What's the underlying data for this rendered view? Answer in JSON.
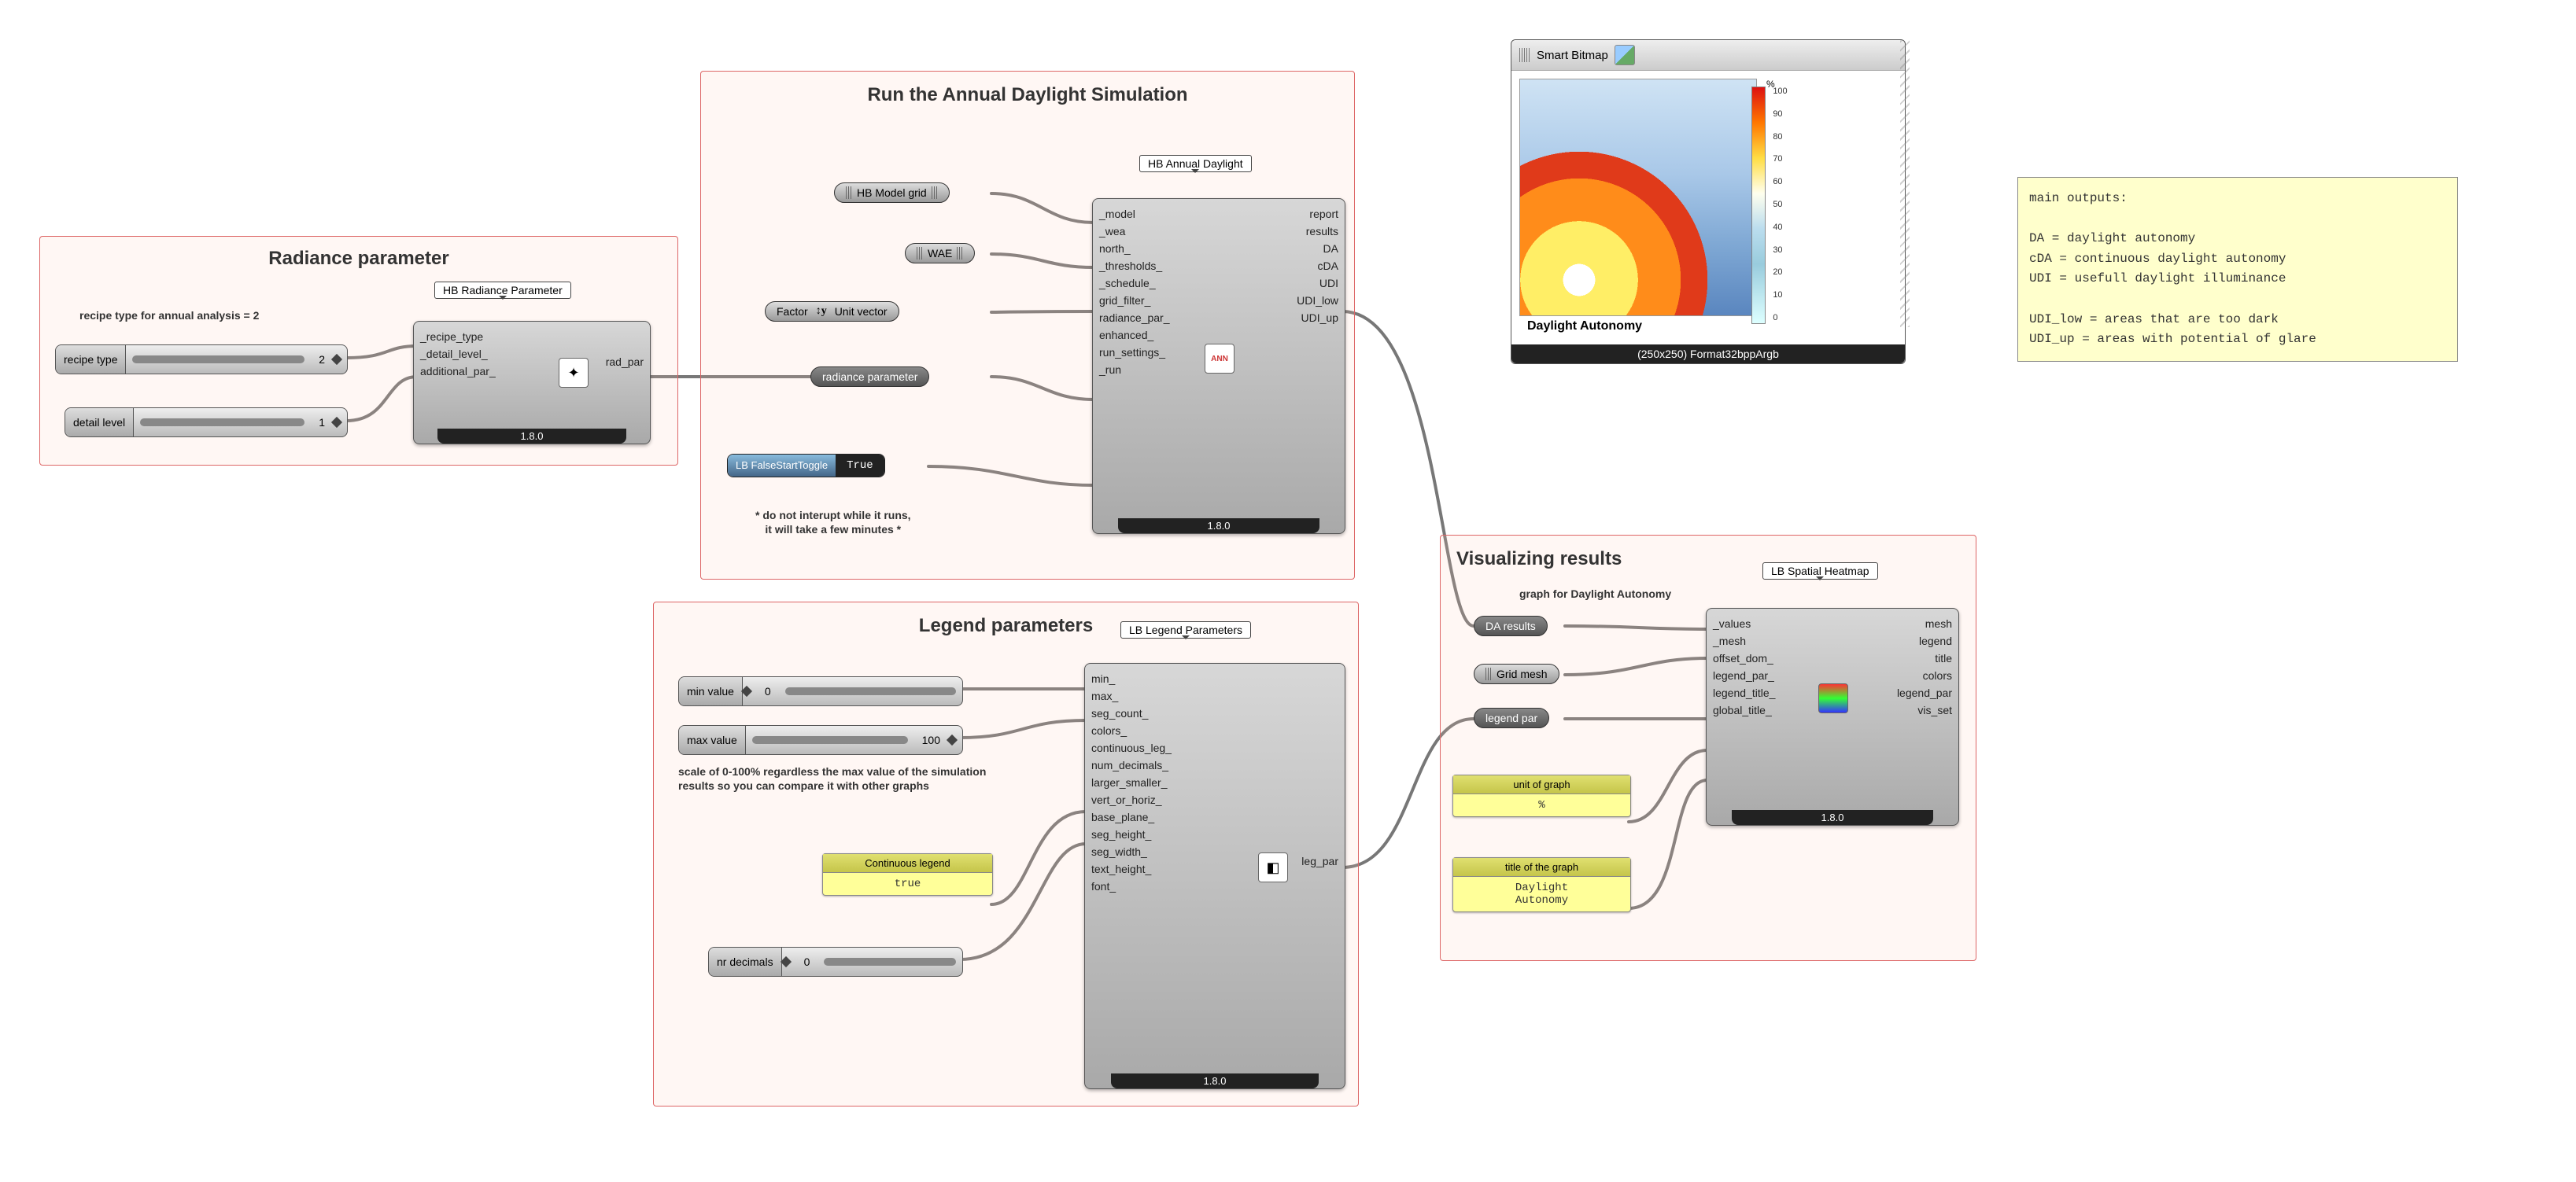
{
  "groups": {
    "radiance": {
      "title": "Radiance parameter",
      "sub": "recipe type for annual analysis = 2"
    },
    "sim": {
      "title": "Run the Annual Daylight Simulation",
      "note": "* do not interupt while it runs,\nit will take a few minutes *"
    },
    "legend": {
      "title": "Legend parameters",
      "note": "scale of 0-100% regardless the max value of the simulation results so you can compare it with other graphs"
    },
    "viz": {
      "title": "Visualizing results",
      "sub": "graph for Daylight Autonomy"
    }
  },
  "labels": {
    "hb_radiance": "HB Radiance Parameter",
    "hb_annual": "HB Annual Daylight",
    "lb_legend": "LB Legend Parameters",
    "lb_heat": "LB Spatial Heatmap"
  },
  "radiance_comp": {
    "inputs": [
      "_recipe_type",
      "_detail_level_",
      "additional_par_"
    ],
    "outputs": [
      "rad_par"
    ],
    "version": "1.8.0"
  },
  "annual_comp": {
    "inputs": [
      "_model",
      "_wea",
      "north_",
      "_thresholds_",
      "_schedule_",
      "grid_filter_",
      "radiance_par_",
      "enhanced_",
      "run_settings_",
      "_run"
    ],
    "outputs": [
      "report",
      "results",
      "DA",
      "cDA",
      "UDI",
      "UDI_low",
      "UDI_up"
    ],
    "version": "1.8.0"
  },
  "legend_comp": {
    "inputs": [
      "min_",
      "max_",
      "seg_count_",
      "colors_",
      "continuous_leg_",
      "num_decimals_",
      "larger_smaller_",
      "vert_or_horiz_",
      "base_plane_",
      "seg_height_",
      "seg_width_",
      "text_height_",
      "font_"
    ],
    "outputs": [
      "leg_par"
    ],
    "version": "1.8.0"
  },
  "heat_comp": {
    "inputs": [
      "_values",
      "_mesh",
      "offset_dom_",
      "legend_par_",
      "legend_title_",
      "global_title_"
    ],
    "outputs": [
      "mesh",
      "legend",
      "title",
      "colors",
      "legend_par",
      "vis_set"
    ],
    "version": "1.8.0"
  },
  "sliders": {
    "recipe_type": {
      "label": "recipe type",
      "value": "2"
    },
    "detail_level": {
      "label": "detail level",
      "value": "1"
    },
    "min_value": {
      "label": "min value",
      "value": "0"
    },
    "max_value": {
      "label": "max value",
      "value": "100"
    },
    "nr_decimals": {
      "label": "nr decimals",
      "value": "0"
    }
  },
  "capsules": {
    "hb_model_grid": "HB Model grid",
    "wae": "WAE",
    "unit_vector": "Unit vector",
    "factor": "Factor",
    "radiance_param": "radiance parameter",
    "da_results": "DA results",
    "grid_mesh": "Grid mesh",
    "legend_par": "legend par"
  },
  "toggle": {
    "label": "LB FalseStartToggle",
    "state": "True"
  },
  "panels": {
    "cont_legend": {
      "title": "Continuous legend",
      "body": "true"
    },
    "unit": {
      "title": "unit of graph",
      "body": "%"
    },
    "title_graph": {
      "title": "title of the graph",
      "body": "Daylight\nAutonomy"
    }
  },
  "bitmap": {
    "title": "Smart Bitmap",
    "caption": "Daylight Autonomy",
    "pct": "%",
    "footer": "(250x250) Format32bppArgb"
  },
  "note": "main outputs:\n\nDA = daylight autonomy\ncDA = continuous daylight autonomy\nUDI = usefull daylight illuminance\n\nUDI_low = areas that are too dark\nUDI_up = areas with potential of glare",
  "chart_data": {
    "type": "heatmap",
    "title": "Daylight Autonomy",
    "unit": "%",
    "legend_ticks": [
      100,
      90,
      80,
      70,
      60,
      50,
      40,
      30,
      20,
      10,
      0
    ],
    "grid_size": [
      250,
      250
    ],
    "note": "pixel-level heatmap values not readable from screenshot; gradient estimated visually — high (red/orange) lower-left, low (pale blue) upper-right"
  }
}
